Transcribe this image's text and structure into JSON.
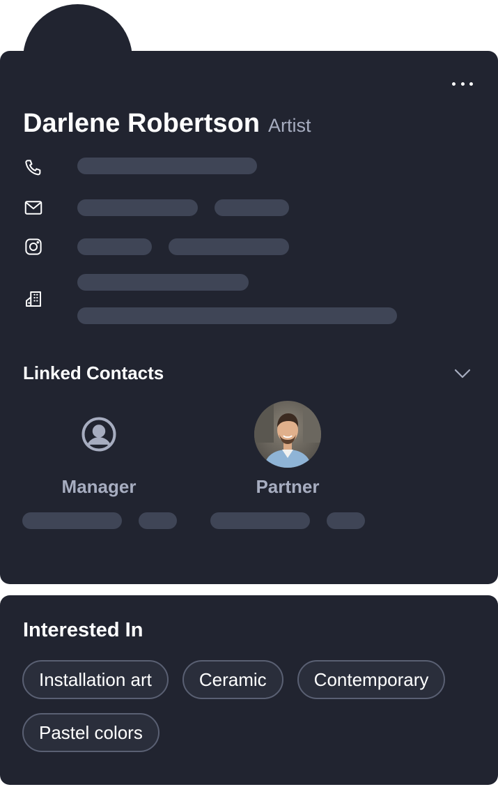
{
  "profile": {
    "name": "Darlene Robertson",
    "role": "Artist"
  },
  "menu": {
    "more_icon": "ellipsis-horizontal-icon"
  },
  "contact_info": {
    "icons": [
      "phone-icon",
      "mail-icon",
      "instagram-icon",
      "building-icon"
    ]
  },
  "linked_contacts": {
    "title": "Linked Contacts",
    "toggle_icon": "chevron-down-icon",
    "contacts": [
      {
        "label": "Manager",
        "avatar": "user-circle-icon"
      },
      {
        "label": "Partner",
        "avatar": "photo"
      }
    ]
  },
  "interests": {
    "title": "Interested In",
    "tags": [
      "Installation art",
      "Ceramic",
      "Contemporary",
      "Pastel colors"
    ]
  },
  "colors": {
    "card_bg": "#212430",
    "placeholder_bar": "#3f4556",
    "muted_text": "#a7adc0",
    "chip_border": "#5a6073"
  }
}
